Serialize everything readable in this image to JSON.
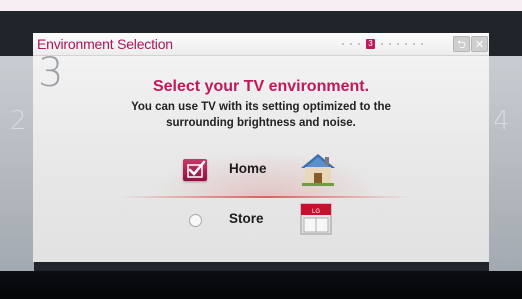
{
  "window": {
    "title": "Environment Selection",
    "current_step": "3",
    "prev_step": "2",
    "next_step": "4"
  },
  "step_number": "3",
  "heading": "Select your TV environment.",
  "description": "You can use TV with its setting optimized to the surrounding brightness and noise.",
  "options": [
    {
      "label": "Home",
      "selected": true,
      "icon": "house-icon"
    },
    {
      "label": "Store",
      "selected": false,
      "icon": "store-icon",
      "icon_text": "LG"
    }
  ],
  "toolbar": {
    "back_icon": "back-icon",
    "close_icon": "close-icon"
  },
  "colors": {
    "accent": "#c2185b",
    "panel": "#ececec",
    "frame": "#20242b"
  }
}
